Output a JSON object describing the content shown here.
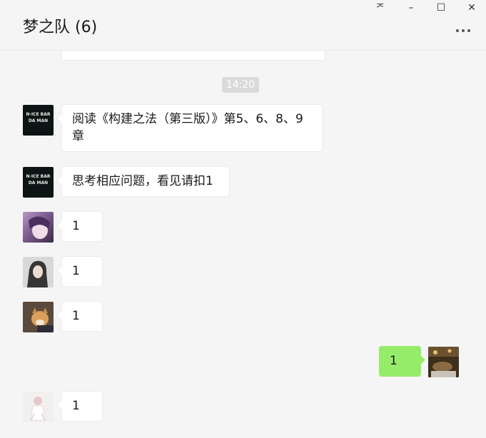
{
  "chat": {
    "title": "梦之队 (6)"
  },
  "window_controls": {
    "pin": "ᅎ",
    "minimize": "–",
    "maximize": "☐",
    "close": "✕"
  },
  "timestamp": "14:20",
  "avatar_text": {
    "line1": "N·ICE BAR",
    "line2": "DA MAN"
  },
  "messages": [
    {
      "sender": "member-1",
      "text": "阅读《构建之法（第三版）》第5、6、8、9章"
    },
    {
      "sender": "member-1",
      "text": "思考相应问题，看见请扣1"
    },
    {
      "sender": "member-2",
      "text": "1"
    },
    {
      "sender": "member-3",
      "text": "1"
    },
    {
      "sender": "member-4",
      "text": "1"
    },
    {
      "sender": "me",
      "text": "1"
    },
    {
      "sender": "member-5",
      "text": "1"
    }
  ],
  "colors": {
    "background": "#f5f5f5",
    "bubble_received": "#ffffff",
    "bubble_sent": "#95ec69",
    "timestamp_bg": "#dadada"
  }
}
